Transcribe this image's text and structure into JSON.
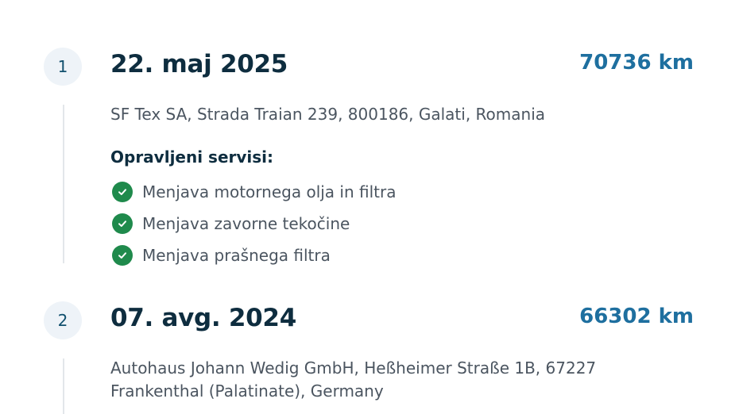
{
  "services_heading": "Opravljeni servisi:",
  "colors": {
    "badge_bg": "#eef3f8",
    "km_accent": "#1e6f9f",
    "check_green": "#1f8a4c",
    "title_dark": "#0e2d3f",
    "body_gray": "#4b5560"
  },
  "entries": [
    {
      "step": "1",
      "date": "22. maj 2025",
      "km": "70736 km",
      "address": "SF Tex SA, Strada Traian 239, 800186, Galati, Romania",
      "services": [
        {
          "label": "Menjava motornega olja in filtra",
          "icon": "check-circle-icon"
        },
        {
          "label": "Menjava zavorne tekočine",
          "icon": "check-circle-icon"
        },
        {
          "label": "Menjava prašnega filtra",
          "icon": "check-circle-icon"
        }
      ]
    },
    {
      "step": "2",
      "date": "07. avg. 2024",
      "km": "66302 km",
      "address": "Autohaus Johann Wedig GmbH, Heßheimer Straße 1B, 67227 Frankenthal (Palatinate), Germany"
    }
  ]
}
